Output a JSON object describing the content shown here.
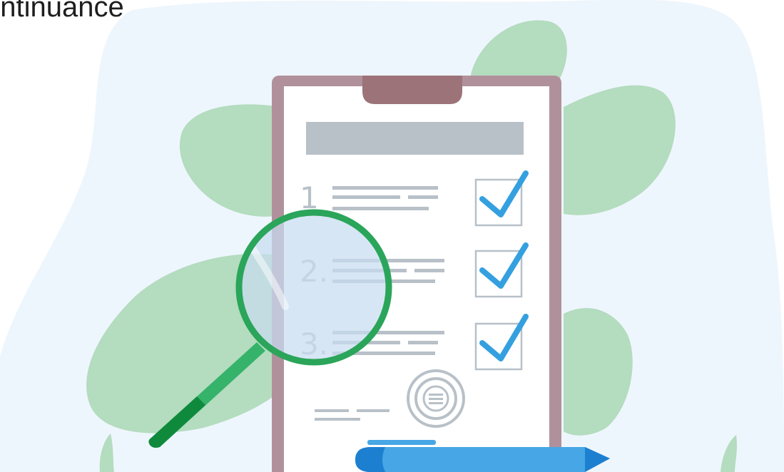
{
  "caption": "ontinuance.",
  "checklist": {
    "items": [
      {
        "number": "1",
        "checked": true
      },
      {
        "number": "2.",
        "checked": true
      },
      {
        "number": "3.",
        "checked": true
      }
    ]
  },
  "icons": {
    "clipboard": "clipboard-icon",
    "magnifier": "magnifying-glass-icon",
    "pen": "pen-icon",
    "stamp": "stamp-seal-icon",
    "check": "checkmark-icon",
    "leaf": "monstera-leaf-icon"
  },
  "colors": {
    "background_blob": "#eef6fd",
    "leaf": "#b4dcbf",
    "clipboard_frame": "#b0919b",
    "clipboard_clip": "#9c7378",
    "paper": "#ffffff",
    "header_bar": "#b8c0c8",
    "text_lines": "#b8c0c8",
    "checkbox_border": "#b8c0c8",
    "check_mark": "#34a0e0",
    "lens_ring": "#2aa55a",
    "lens_glass": "#c7dcf0",
    "handle": "#36b36a",
    "handle_dark": "#0f8a3c",
    "pen_body": "#47a6e5",
    "pen_dark": "#1d7fd0"
  }
}
